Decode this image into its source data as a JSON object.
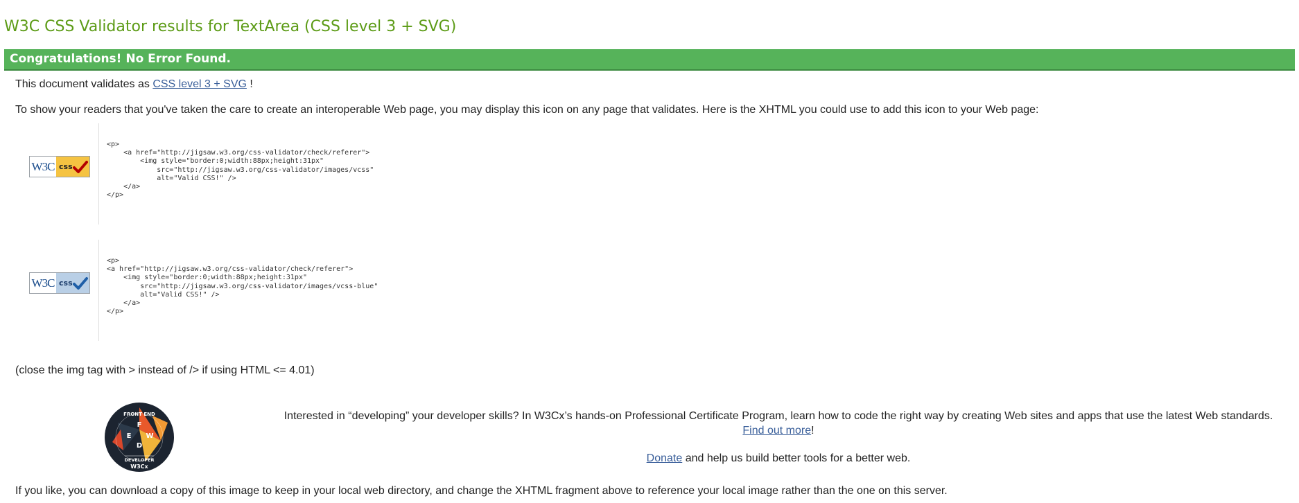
{
  "page": {
    "title": "W3C CSS Validator results for TextArea (CSS level 3 + SVG)"
  },
  "banner": {
    "text": "Congratulations! No Error Found.",
    "color": "#56b35a"
  },
  "validates": {
    "prefix": "This document validates as ",
    "link": "CSS level 3 + SVG",
    "suffix": " !"
  },
  "intro": {
    "text": "To show your readers that you've taken the care to create an interoperable Web page, you may display this icon on any page that validates. Here is the XHTML you could use to add this icon to your Web page:"
  },
  "icons": [
    {
      "badge_w3c": "W3C",
      "badge_css": "css",
      "variant": "gold",
      "tick_color": "#b30000",
      "code": "<p>\n    <a href=\"http://jigsaw.w3.org/css-validator/check/referer\">\n        <img style=\"border:0;width:88px;height:31px\"\n            src=\"http://jigsaw.w3.org/css-validator/images/vcss\"\n            alt=\"Valid CSS!\" />\n    </a>\n</p>"
    },
    {
      "badge_w3c": "W3C",
      "badge_css": "css",
      "variant": "blue",
      "tick_color": "#1f5fa8",
      "code": "<p>\n<a href=\"http://jigsaw.w3.org/css-validator/check/referer\">\n    <img style=\"border:0;width:88px;height:31px\"\n        src=\"http://jigsaw.w3.org/css-validator/images/vcss-blue\"\n        alt=\"Valid CSS!\" />\n    </a>\n</p>"
    }
  ],
  "note": {
    "text": "(close the img tag with > instead of /> if using HTML <= 4.01)"
  },
  "promo": {
    "logo_text_top": "FRONT END",
    "logo_text_bottom": "DEVELOPER",
    "logo_letters": [
      "F",
      "E",
      "W",
      "D"
    ],
    "logo_brand": "W3Cx",
    "text": "Interested in “developing” your developer skills? In W3Cx’s hands-on Professional Certificate Program, learn how to code the right way by creating Web sites and apps that use the latest Web standards.",
    "link": "Find out more",
    "link_suffix": "!",
    "donate_link": "Donate",
    "donate_suffix": " and help us build better tools for a better web."
  },
  "download": {
    "text": "If you like, you can download a copy of this image to keep in your local web directory, and change the XHTML fragment above to reference your local image rather than the one on this server."
  },
  "colors": {
    "title": "#5c9b16",
    "link": "#3a5f9a",
    "badge_gold": "#f5c342",
    "badge_blue": "#b9cfe6"
  }
}
